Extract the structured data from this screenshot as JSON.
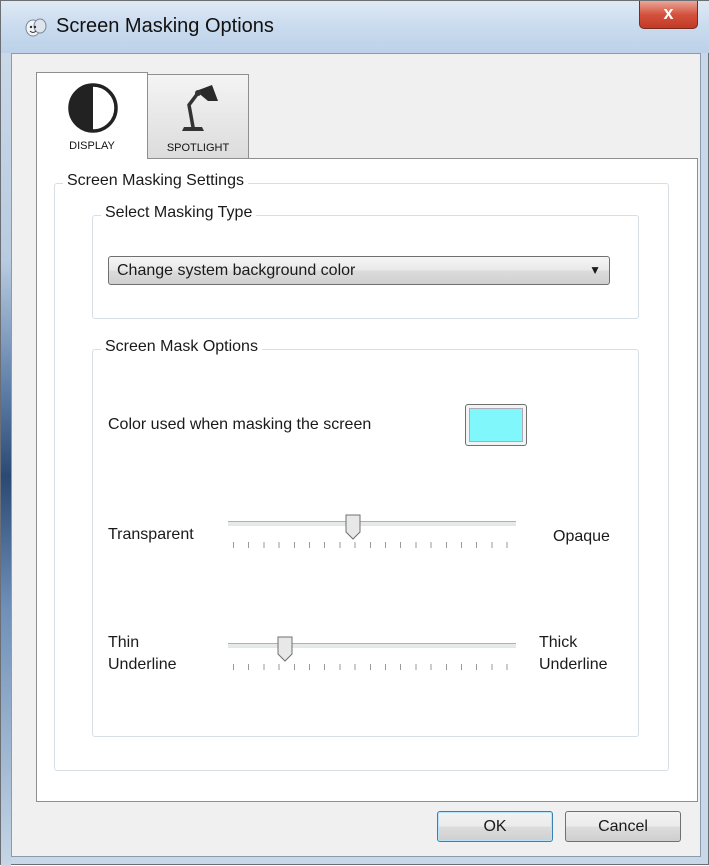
{
  "window": {
    "title": "Screen Masking Options",
    "close_glyph": "x"
  },
  "tabs": [
    {
      "label": "DISPLAY",
      "icon": "contrast-icon",
      "selected": true
    },
    {
      "label": "SPOTLIGHT",
      "icon": "desk-lamp-icon",
      "selected": false
    }
  ],
  "settings": {
    "group_title": "Screen Masking Settings",
    "masking_type": {
      "group_title": "Select Masking Type",
      "selected": "Change system background color"
    },
    "mask_options": {
      "group_title": "Screen Mask Options",
      "color_label": "Color used when masking the screen",
      "color_value": "#7ff7fb",
      "opacity_slider": {
        "min_label": "Transparent",
        "max_label": "Opaque",
        "value": 0.43
      },
      "underline_slider": {
        "min_label_1": "Thin",
        "min_label_2": "Underline",
        "max_label_1": "Thick",
        "max_label_2": "Underline",
        "value": 0.18
      }
    }
  },
  "buttons": {
    "ok": "OK",
    "cancel": "Cancel"
  }
}
